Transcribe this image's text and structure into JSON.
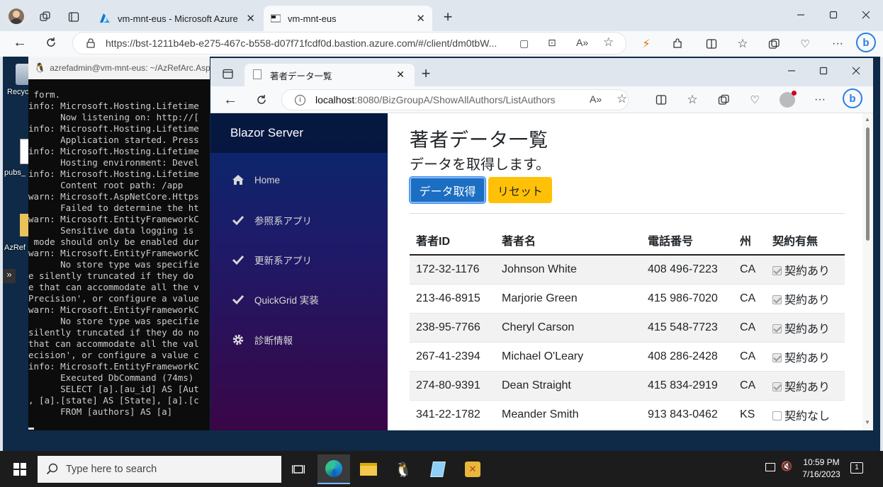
{
  "outer_browser": {
    "tabs": [
      {
        "label": "vm-mnt-eus - Microsoft Azure"
      },
      {
        "label": "vm-mnt-eus"
      }
    ],
    "url": "https://bst-1211b4eb-e275-467c-b558-d07f71fcdf0d.bastion.azure.com/#/client/dm0tbW..."
  },
  "desktop": {
    "icons": [
      "Recyc",
      "pubs_",
      "AzRef"
    ]
  },
  "terminal": {
    "title": "azrefadmin@vm-mnt-eus: ~/AzRefArc.Asp",
    "lines": [
      " form.",
      "info: Microsoft.Hosting.Lifetime",
      "      Now listening on: http://[",
      "info: Microsoft.Hosting.Lifetime",
      "      Application started. Press",
      "info: Microsoft.Hosting.Lifetime",
      "      Hosting environment: Devel",
      "info: Microsoft.Hosting.Lifetime",
      "      Content root path: /app",
      "warn: Microsoft.AspNetCore.Https",
      "      Failed to determine the ht",
      "warn: Microsoft.EntityFrameworkC",
      "      Sensitive data logging is ",
      " mode should only be enabled dur",
      "warn: Microsoft.EntityFrameworkC",
      "      No store type was specifie",
      "e silently truncated if they do ",
      "e that can accommodate all the v",
      "Precision', or configure a value",
      "warn: Microsoft.EntityFrameworkC",
      "      No store type was specifie",
      "silently truncated if they do no",
      "that can accommodate all the val",
      "ecision', or configure a value c",
      "info: Microsoft.EntityFrameworkC",
      "      Executed DbCommand (74ms) ",
      "      SELECT [a].[au_id] AS [Aut",
      ", [a].[state] AS [State], [a].[c",
      "      FROM [authors] AS [a]"
    ]
  },
  "inner_browser": {
    "tab_label": "著者データ一覧",
    "url_host": "localhost",
    "url_rest": ":8080/BizGroupA/ShowAllAuthors/ListAuthors"
  },
  "app": {
    "brand": "Blazor Server",
    "nav": [
      {
        "label": "Home",
        "icon": "home-icon"
      },
      {
        "label": "参照系アプリ",
        "icon": "check-icon"
      },
      {
        "label": "更新系アプリ",
        "icon": "check-icon"
      },
      {
        "label": "QuickGrid 実装",
        "icon": "check-icon"
      },
      {
        "label": "診断情報",
        "icon": "gear-icon"
      }
    ],
    "page_title": "著者データ一覧",
    "subtitle": "データを取得します。",
    "fetch_button": "データ取得",
    "reset_button": "リセット",
    "table": {
      "headers": [
        "著者ID",
        "著者名",
        "電話番号",
        "州",
        "契約有無"
      ],
      "rows": [
        {
          "id": "172-32-1176",
          "name": "Johnson White",
          "phone": "408 496-7223",
          "state": "CA",
          "contract": true,
          "contract_label": "契約あり"
        },
        {
          "id": "213-46-8915",
          "name": "Marjorie Green",
          "phone": "415 986-7020",
          "state": "CA",
          "contract": true,
          "contract_label": "契約あり"
        },
        {
          "id": "238-95-7766",
          "name": "Cheryl Carson",
          "phone": "415 548-7723",
          "state": "CA",
          "contract": true,
          "contract_label": "契約あり"
        },
        {
          "id": "267-41-2394",
          "name": "Michael O'Leary",
          "phone": "408 286-2428",
          "state": "CA",
          "contract": true,
          "contract_label": "契約あり"
        },
        {
          "id": "274-80-9391",
          "name": "Dean Straight",
          "phone": "415 834-2919",
          "state": "CA",
          "contract": true,
          "contract_label": "契約あり"
        },
        {
          "id": "341-22-1782",
          "name": "Meander Smith",
          "phone": "913 843-0462",
          "state": "KS",
          "contract": false,
          "contract_label": "契約なし"
        }
      ]
    }
  },
  "taskbar": {
    "search_placeholder": "Type here to search",
    "time": "10:59 PM",
    "date": "7/16/2023",
    "notification_count": "1"
  }
}
